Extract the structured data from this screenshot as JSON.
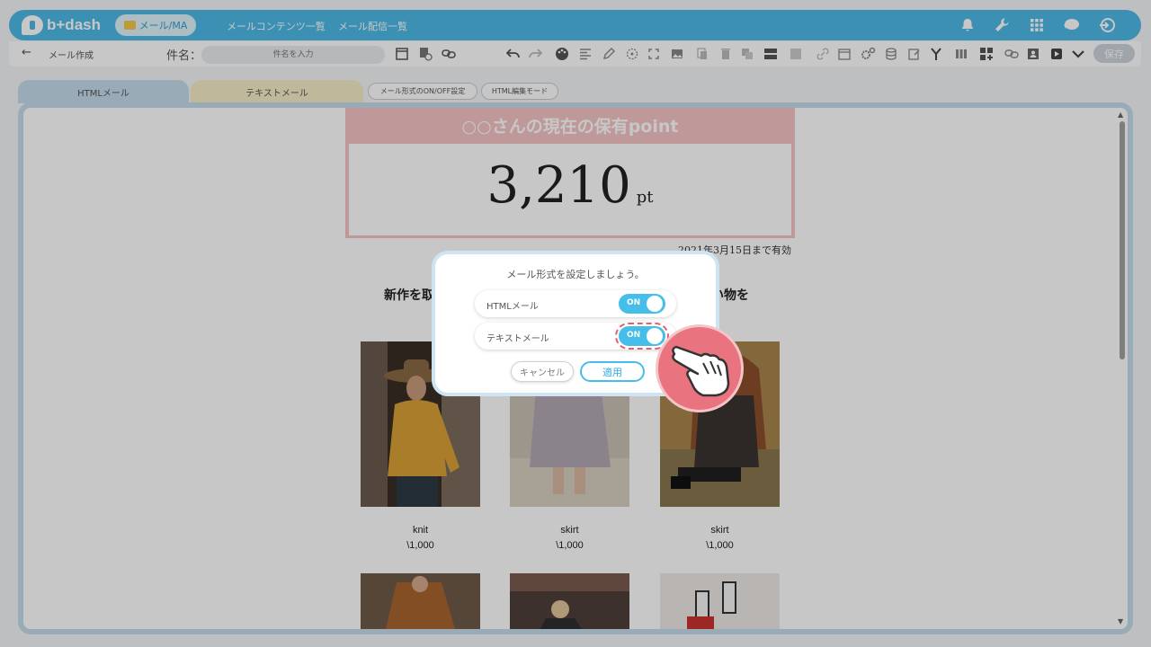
{
  "header": {
    "logo_text": "b+dash",
    "module_label": "メール/MA",
    "nav": [
      "メールコンテンツ一覧",
      "メール配信一覧"
    ],
    "icons": [
      "bell-icon",
      "wrench-icon",
      "grid-icon",
      "chat-icon",
      "logout-icon"
    ]
  },
  "toolbar": {
    "back_label": "←",
    "crumb": "メール作成",
    "subject_label": "件名：",
    "subject_placeholder": "件名を入力",
    "save_label": "保存"
  },
  "tabs": {
    "html": "HTMLメール",
    "text": "テキストメール",
    "onoff": "メール形式のON/OFF設定",
    "edit_mode": "HTML編集モード"
  },
  "mail": {
    "point_title": "○○さんの現在の保有point",
    "point_value": "3,210",
    "point_unit": "pt",
    "expiry": "2021年3月15日まで有効",
    "promo_left": "新作を取",
    "promo_right": "い物を",
    "products": [
      {
        "name": "knit",
        "price": "\\1,000"
      },
      {
        "name": "skirt",
        "price": "\\1,000"
      },
      {
        "name": "skirt",
        "price": "\\1,000"
      }
    ]
  },
  "dialog": {
    "message": "メール形式を設定しましょう。",
    "options": [
      {
        "label": "HTMLメール",
        "state": "ON"
      },
      {
        "label": "テキストメール",
        "state": "ON"
      }
    ],
    "cancel_label": "キャンセル",
    "apply_label": "適用"
  },
  "colors": {
    "brand": "#4eb9e6",
    "toggle_on": "#45bfea",
    "highlight": "#e45f6c",
    "point_band": "#f5c4c4"
  }
}
